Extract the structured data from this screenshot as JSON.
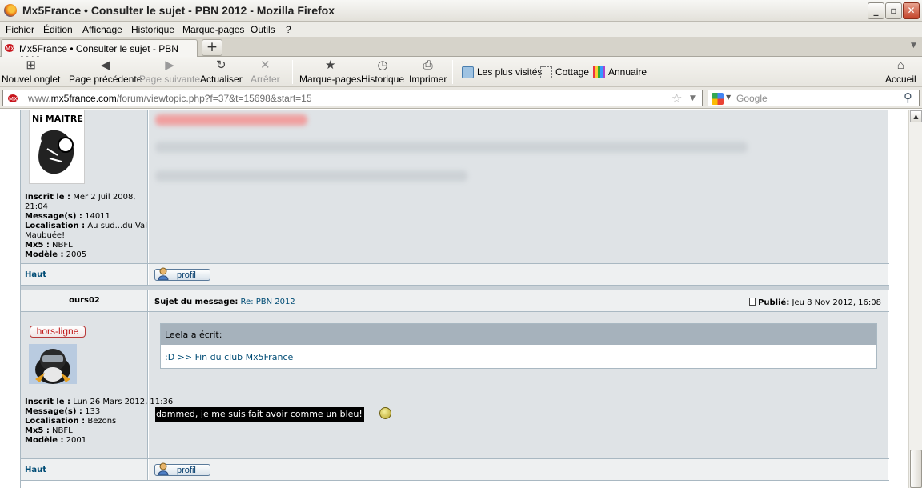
{
  "window": {
    "title": "Mx5France • Consulter le sujet - PBN 2012 - Mozilla Firefox"
  },
  "menu": [
    "Fichier",
    "Édition",
    "Affichage",
    "Historique",
    "Marque-pages",
    "Outils",
    "?"
  ],
  "tab": {
    "title": "Mx5France • Consulter le sujet - PBN 2012",
    "new_tab": "+"
  },
  "toolbar": {
    "new_tab": "Nouvel onglet",
    "back": "Page précédente",
    "forward": "Page suivante",
    "reload": "Actualiser",
    "stop": "Arrêter",
    "bookmarks": "Marque-pages",
    "history": "Historique",
    "print": "Imprimer",
    "home": "Accueil"
  },
  "bookmarks_bar": [
    "Les plus visités",
    "Cottage",
    "Annuaire"
  ],
  "location": {
    "url_prefix": "www.",
    "url_domain": "mx5france.com",
    "url_path": "/forum/viewtopic.php?f=37&t=15698&start=15"
  },
  "search": {
    "placeholder": "Google"
  },
  "post1": {
    "details": [
      {
        "label": "Inscrit le :",
        "value": "Mer 2 Juil 2008, 21:04"
      },
      {
        "label": "Message(s) :",
        "value": "14011"
      },
      {
        "label": "Localisation :",
        "value": "Au sud...du Val Maubuée!"
      },
      {
        "label": "Mx5 :",
        "value": "NBFL"
      },
      {
        "label": "Modèle :",
        "value": "2005"
      }
    ],
    "top_link": "Haut",
    "profile_button": "profil"
  },
  "post2": {
    "author": "ours02",
    "subject_label": "Sujet du message:",
    "subject": "Re: PBN 2012",
    "posted_label": "Publié:",
    "posted_date": "Jeu 8 Nov 2012, 16:08",
    "status": "hors-ligne",
    "details": [
      {
        "label": "Inscrit le :",
        "value": "Lun 26 Mars 2012, 11:36"
      },
      {
        "label": "Message(s) :",
        "value": "133"
      },
      {
        "label": "Localisation :",
        "value": "Bezons"
      },
      {
        "label": "Mx5 :",
        "value": "NBFL"
      },
      {
        "label": "Modèle :",
        "value": "2001"
      }
    ],
    "quote_author": "Leela a écrit:",
    "quote_text": ":D >> Fin du club Mx5France",
    "reply_text": "dammed, je me suis fait avoir comme un bleu!",
    "top_link": "Haut",
    "profile_button": "profil"
  }
}
